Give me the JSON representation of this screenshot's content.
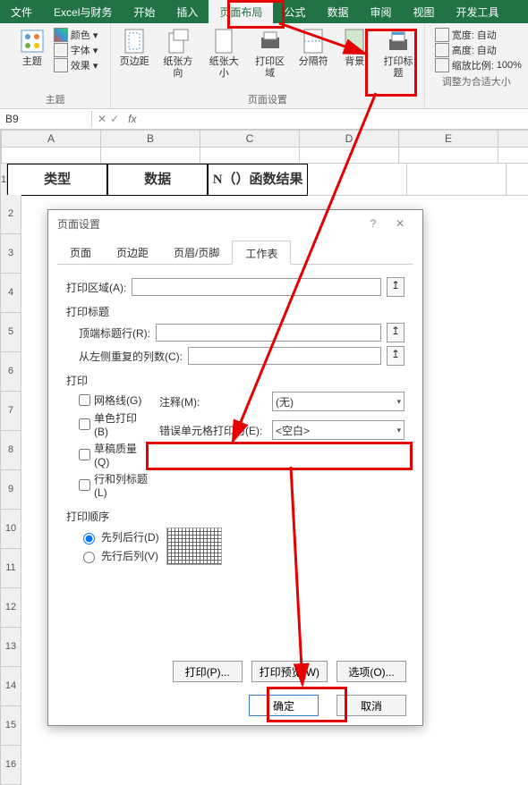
{
  "tabs": [
    "文件",
    "Excel与财务",
    "开始",
    "插入",
    "页面布局",
    "公式",
    "数据",
    "审阅",
    "视图",
    "开发工具"
  ],
  "active_tab": 4,
  "ribbon": {
    "group1": {
      "label": "主题",
      "items": [
        "颜色 ▾",
        "字体 ▾",
        "效果 ▾"
      ],
      "big": "主题"
    },
    "group2": {
      "label": "页面设置",
      "btns": [
        "页边距",
        "纸张方向",
        "纸张大小",
        "打印区域",
        "分隔符",
        "背景",
        "打印标题"
      ]
    },
    "group3": {
      "label": "调整为合适大小",
      "rows": [
        {
          "l": "宽度:",
          "v": "自动"
        },
        {
          "l": "高度:",
          "v": "自动"
        },
        {
          "l": "缩放比例:",
          "v": "100%"
        }
      ]
    }
  },
  "cellref": "B9",
  "headers": [
    "类型",
    "数据",
    "N（）函数结果"
  ],
  "dialog": {
    "title": "页面设置",
    "tabs": [
      "页面",
      "页边距",
      "页眉/页脚",
      "工作表"
    ],
    "active": 3,
    "print_area": "打印区域(A):",
    "sect_titles": "打印标题",
    "top_row": "顶端标题行(R):",
    "left_col": "从左侧重复的列数(C):",
    "sect_print": "打印",
    "cb": [
      "网格线(G)",
      "单色打印(B)",
      "草稿质量(Q)",
      "行和列标题(L)"
    ],
    "comments_l": "注释(M):",
    "comments_v": "(无)",
    "error_l": "错误单元格打印为(E):",
    "error_v": "<空白>",
    "sect_order": "打印顺序",
    "radios": [
      "先列后行(D)",
      "先行后列(V)"
    ],
    "btns": [
      "打印(P)...",
      "打印预览(W)",
      "选项(O)..."
    ],
    "ok": "确定",
    "cancel": "取消"
  }
}
